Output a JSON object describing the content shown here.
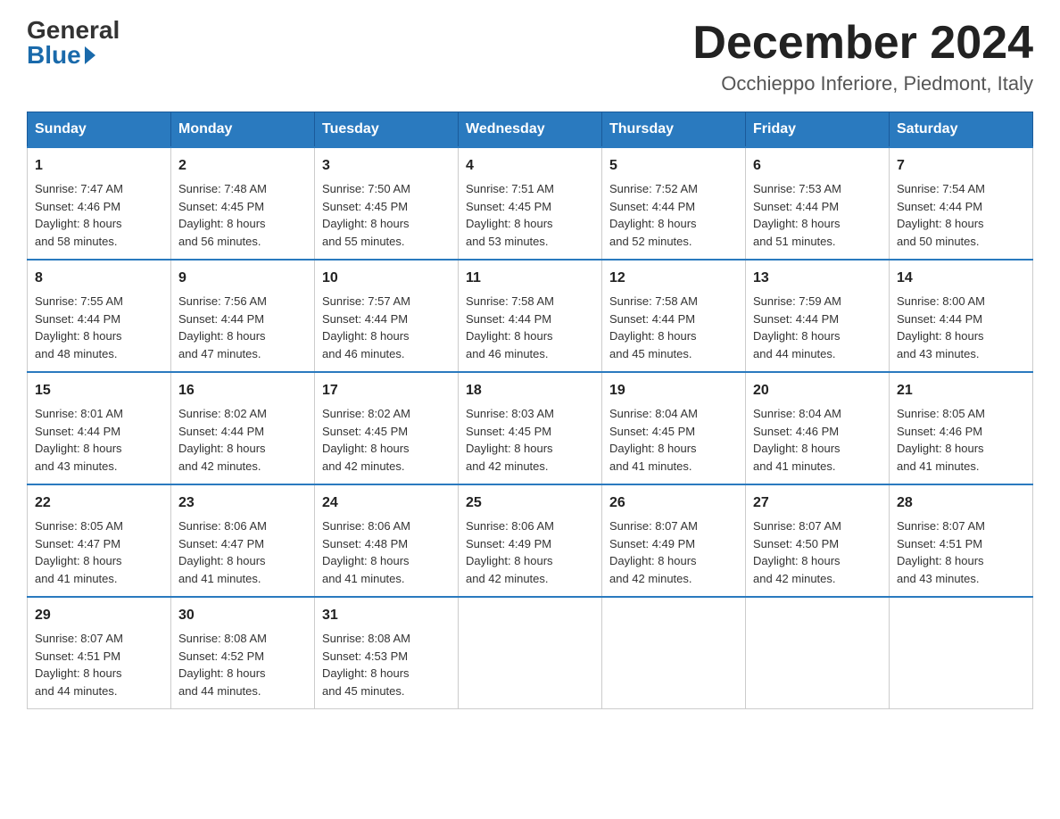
{
  "logo": {
    "general": "General",
    "blue": "Blue"
  },
  "header": {
    "month_year": "December 2024",
    "location": "Occhieppo Inferiore, Piedmont, Italy"
  },
  "days_of_week": [
    "Sunday",
    "Monday",
    "Tuesday",
    "Wednesday",
    "Thursday",
    "Friday",
    "Saturday"
  ],
  "weeks": [
    [
      {
        "day": "1",
        "sunrise": "Sunrise: 7:47 AM",
        "sunset": "Sunset: 4:46 PM",
        "daylight": "Daylight: 8 hours",
        "daylight2": "and 58 minutes."
      },
      {
        "day": "2",
        "sunrise": "Sunrise: 7:48 AM",
        "sunset": "Sunset: 4:45 PM",
        "daylight": "Daylight: 8 hours",
        "daylight2": "and 56 minutes."
      },
      {
        "day": "3",
        "sunrise": "Sunrise: 7:50 AM",
        "sunset": "Sunset: 4:45 PM",
        "daylight": "Daylight: 8 hours",
        "daylight2": "and 55 minutes."
      },
      {
        "day": "4",
        "sunrise": "Sunrise: 7:51 AM",
        "sunset": "Sunset: 4:45 PM",
        "daylight": "Daylight: 8 hours",
        "daylight2": "and 53 minutes."
      },
      {
        "day": "5",
        "sunrise": "Sunrise: 7:52 AM",
        "sunset": "Sunset: 4:44 PM",
        "daylight": "Daylight: 8 hours",
        "daylight2": "and 52 minutes."
      },
      {
        "day": "6",
        "sunrise": "Sunrise: 7:53 AM",
        "sunset": "Sunset: 4:44 PM",
        "daylight": "Daylight: 8 hours",
        "daylight2": "and 51 minutes."
      },
      {
        "day": "7",
        "sunrise": "Sunrise: 7:54 AM",
        "sunset": "Sunset: 4:44 PM",
        "daylight": "Daylight: 8 hours",
        "daylight2": "and 50 minutes."
      }
    ],
    [
      {
        "day": "8",
        "sunrise": "Sunrise: 7:55 AM",
        "sunset": "Sunset: 4:44 PM",
        "daylight": "Daylight: 8 hours",
        "daylight2": "and 48 minutes."
      },
      {
        "day": "9",
        "sunrise": "Sunrise: 7:56 AM",
        "sunset": "Sunset: 4:44 PM",
        "daylight": "Daylight: 8 hours",
        "daylight2": "and 47 minutes."
      },
      {
        "day": "10",
        "sunrise": "Sunrise: 7:57 AM",
        "sunset": "Sunset: 4:44 PM",
        "daylight": "Daylight: 8 hours",
        "daylight2": "and 46 minutes."
      },
      {
        "day": "11",
        "sunrise": "Sunrise: 7:58 AM",
        "sunset": "Sunset: 4:44 PM",
        "daylight": "Daylight: 8 hours",
        "daylight2": "and 46 minutes."
      },
      {
        "day": "12",
        "sunrise": "Sunrise: 7:58 AM",
        "sunset": "Sunset: 4:44 PM",
        "daylight": "Daylight: 8 hours",
        "daylight2": "and 45 minutes."
      },
      {
        "day": "13",
        "sunrise": "Sunrise: 7:59 AM",
        "sunset": "Sunset: 4:44 PM",
        "daylight": "Daylight: 8 hours",
        "daylight2": "and 44 minutes."
      },
      {
        "day": "14",
        "sunrise": "Sunrise: 8:00 AM",
        "sunset": "Sunset: 4:44 PM",
        "daylight": "Daylight: 8 hours",
        "daylight2": "and 43 minutes."
      }
    ],
    [
      {
        "day": "15",
        "sunrise": "Sunrise: 8:01 AM",
        "sunset": "Sunset: 4:44 PM",
        "daylight": "Daylight: 8 hours",
        "daylight2": "and 43 minutes."
      },
      {
        "day": "16",
        "sunrise": "Sunrise: 8:02 AM",
        "sunset": "Sunset: 4:44 PM",
        "daylight": "Daylight: 8 hours",
        "daylight2": "and 42 minutes."
      },
      {
        "day": "17",
        "sunrise": "Sunrise: 8:02 AM",
        "sunset": "Sunset: 4:45 PM",
        "daylight": "Daylight: 8 hours",
        "daylight2": "and 42 minutes."
      },
      {
        "day": "18",
        "sunrise": "Sunrise: 8:03 AM",
        "sunset": "Sunset: 4:45 PM",
        "daylight": "Daylight: 8 hours",
        "daylight2": "and 42 minutes."
      },
      {
        "day": "19",
        "sunrise": "Sunrise: 8:04 AM",
        "sunset": "Sunset: 4:45 PM",
        "daylight": "Daylight: 8 hours",
        "daylight2": "and 41 minutes."
      },
      {
        "day": "20",
        "sunrise": "Sunrise: 8:04 AM",
        "sunset": "Sunset: 4:46 PM",
        "daylight": "Daylight: 8 hours",
        "daylight2": "and 41 minutes."
      },
      {
        "day": "21",
        "sunrise": "Sunrise: 8:05 AM",
        "sunset": "Sunset: 4:46 PM",
        "daylight": "Daylight: 8 hours",
        "daylight2": "and 41 minutes."
      }
    ],
    [
      {
        "day": "22",
        "sunrise": "Sunrise: 8:05 AM",
        "sunset": "Sunset: 4:47 PM",
        "daylight": "Daylight: 8 hours",
        "daylight2": "and 41 minutes."
      },
      {
        "day": "23",
        "sunrise": "Sunrise: 8:06 AM",
        "sunset": "Sunset: 4:47 PM",
        "daylight": "Daylight: 8 hours",
        "daylight2": "and 41 minutes."
      },
      {
        "day": "24",
        "sunrise": "Sunrise: 8:06 AM",
        "sunset": "Sunset: 4:48 PM",
        "daylight": "Daylight: 8 hours",
        "daylight2": "and 41 minutes."
      },
      {
        "day": "25",
        "sunrise": "Sunrise: 8:06 AM",
        "sunset": "Sunset: 4:49 PM",
        "daylight": "Daylight: 8 hours",
        "daylight2": "and 42 minutes."
      },
      {
        "day": "26",
        "sunrise": "Sunrise: 8:07 AM",
        "sunset": "Sunset: 4:49 PM",
        "daylight": "Daylight: 8 hours",
        "daylight2": "and 42 minutes."
      },
      {
        "day": "27",
        "sunrise": "Sunrise: 8:07 AM",
        "sunset": "Sunset: 4:50 PM",
        "daylight": "Daylight: 8 hours",
        "daylight2": "and 42 minutes."
      },
      {
        "day": "28",
        "sunrise": "Sunrise: 8:07 AM",
        "sunset": "Sunset: 4:51 PM",
        "daylight": "Daylight: 8 hours",
        "daylight2": "and 43 minutes."
      }
    ],
    [
      {
        "day": "29",
        "sunrise": "Sunrise: 8:07 AM",
        "sunset": "Sunset: 4:51 PM",
        "daylight": "Daylight: 8 hours",
        "daylight2": "and 44 minutes."
      },
      {
        "day": "30",
        "sunrise": "Sunrise: 8:08 AM",
        "sunset": "Sunset: 4:52 PM",
        "daylight": "Daylight: 8 hours",
        "daylight2": "and 44 minutes."
      },
      {
        "day": "31",
        "sunrise": "Sunrise: 8:08 AM",
        "sunset": "Sunset: 4:53 PM",
        "daylight": "Daylight: 8 hours",
        "daylight2": "and 45 minutes."
      },
      null,
      null,
      null,
      null
    ]
  ]
}
